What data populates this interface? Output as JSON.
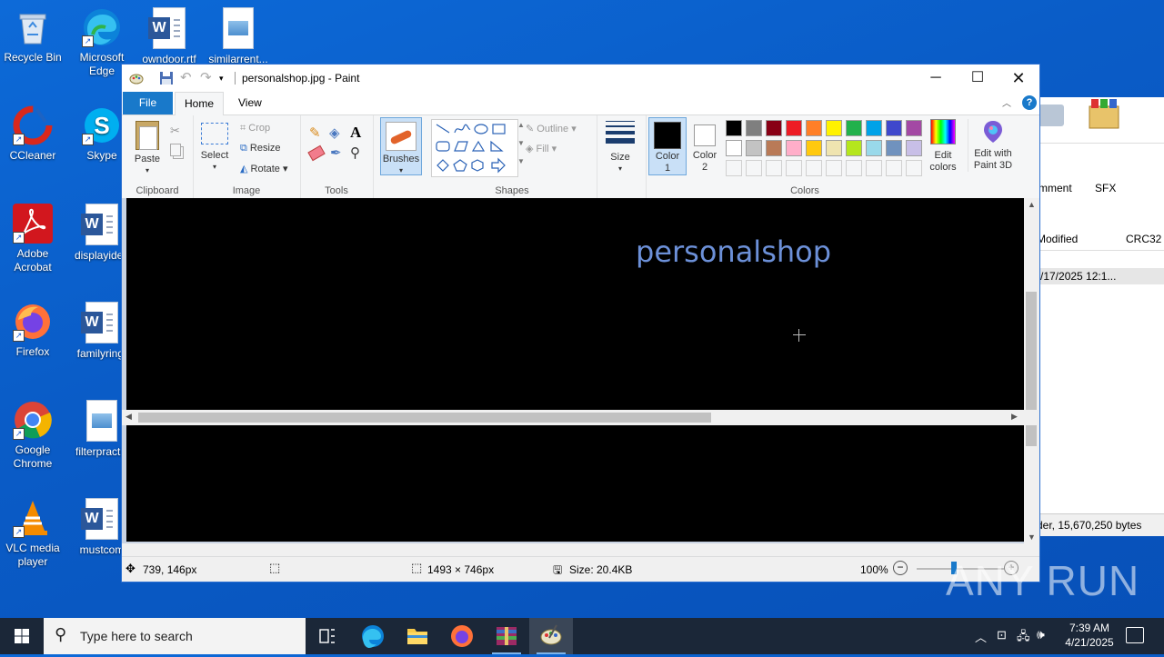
{
  "desktop": {
    "icons": [
      {
        "label": "Recycle Bin"
      },
      {
        "label": "Microsoft Edge"
      },
      {
        "label": "owndoor.rtf"
      },
      {
        "label": "similarrent..."
      },
      {
        "label": "CCleaner"
      },
      {
        "label": "Skype"
      },
      {
        "label": "Adobe Acrobat"
      },
      {
        "label": "displayidea"
      },
      {
        "label": "Firefox"
      },
      {
        "label": "familyring."
      },
      {
        "label": "Google Chrome"
      },
      {
        "label": "filterpractic"
      },
      {
        "label": "VLC media player"
      },
      {
        "label": "mustcom"
      }
    ]
  },
  "background_window": {
    "toolbar": [
      "mment",
      "SFX"
    ],
    "columns": [
      "Modified",
      "CRC32"
    ],
    "row_modified": "/17/2025 12:1...",
    "status": "der, 15,670,250 bytes"
  },
  "paint": {
    "title": "personalshop.jpg - Paint",
    "tabs": {
      "file": "File",
      "home": "Home",
      "view": "View"
    },
    "ribbon": {
      "clipboard": {
        "label": "Clipboard",
        "paste": "Paste"
      },
      "image": {
        "label": "Image",
        "select": "Select",
        "crop": "Crop",
        "resize": "Resize",
        "rotate": "Rotate"
      },
      "tools": {
        "label": "Tools"
      },
      "brushes": {
        "label": "Brushes"
      },
      "shapes": {
        "label": "Shapes",
        "outline": "Outline",
        "fill": "Fill"
      },
      "size": {
        "label": "Size"
      },
      "colors": {
        "label": "Colors",
        "color1": "Color 1",
        "color2": "Color 2",
        "edit_colors": "Edit colors",
        "edit_paint3d": "Edit with Paint 3D",
        "color1_value": "#000000",
        "color2_value": "#ffffff",
        "palette_row1": [
          "#000000",
          "#7f7f7f",
          "#880015",
          "#ed1c24",
          "#ff7f27",
          "#fff200",
          "#22b14c",
          "#00a2e8",
          "#3f48cc",
          "#a349a4"
        ],
        "palette_row2": [
          "#ffffff",
          "#c3c3c3",
          "#b97a57",
          "#ffaec9",
          "#ffc90e",
          "#efe4b0",
          "#b5e61d",
          "#99d9ea",
          "#7092be",
          "#c8bfe7"
        ]
      }
    },
    "canvas_text": "personalshop",
    "canvas_text_color": "#6c90d8",
    "status": {
      "cursor_pos": "739, 146px",
      "image_size": "1493 × 746px",
      "file_size": "Size: 20.4KB",
      "zoom": "100%"
    }
  },
  "taskbar": {
    "search_placeholder": "Type here to search",
    "time": "7:39 AM",
    "date": "4/21/2025"
  },
  "watermark": "ANY RUN"
}
